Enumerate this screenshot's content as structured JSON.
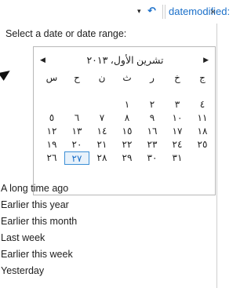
{
  "search": {
    "query": "datemodified:",
    "dropdown_icon": "▾",
    "back_icon": "↶",
    "close_icon": "×"
  },
  "panel": {
    "prompt": "Select a date or date range:"
  },
  "calendar": {
    "month_title": "تشرين الأول، ٢٠١٣",
    "prev_icon": "◀",
    "next_icon": "▶",
    "weekdays": [
      "ج",
      "خ",
      "ر",
      "ث",
      "ن",
      "ح",
      "س"
    ],
    "weeks": [
      [
        "",
        "",
        "",
        "",
        "",
        "",
        ""
      ],
      [
        "٤",
        "٣",
        "٢",
        "١",
        "",
        "",
        ""
      ],
      [
        "١١",
        "١٠",
        "٩",
        "٨",
        "٧",
        "٦",
        "٥"
      ],
      [
        "١٨",
        "١٧",
        "١٦",
        "١٥",
        "١٤",
        "١٣",
        "١٢"
      ],
      [
        "٢٥",
        "٢٤",
        "٢٣",
        "٢٢",
        "٢١",
        "٢٠",
        "١٩"
      ],
      [
        "",
        "٣١",
        "٣٠",
        "٢٩",
        "٢٨",
        "٢٧",
        "٢٦"
      ]
    ],
    "today": "٢٧"
  },
  "date_ranges": [
    "A long time ago",
    "Earlier this year",
    "Earlier this month",
    "Last week",
    "Earlier this week",
    "Yesterday"
  ],
  "colors": {
    "accent": "#1a6fc9",
    "today_bg": "#e8f2fb"
  }
}
